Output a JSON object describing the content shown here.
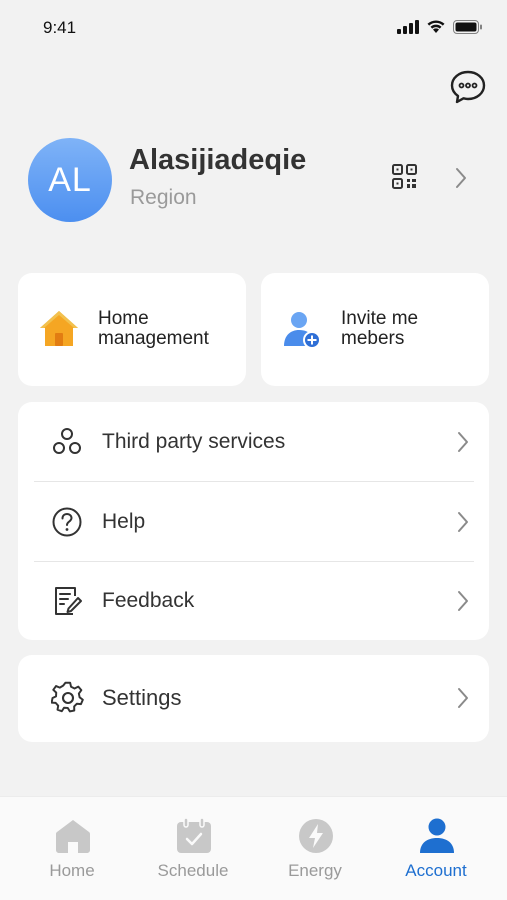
{
  "status_bar": {
    "time": "9:41"
  },
  "profile": {
    "initials": "AL",
    "name": "Alasijiadeqie",
    "region": "Region"
  },
  "tiles": {
    "home": {
      "label_line1": "Home",
      "label_line2": "management",
      "icon": "house-icon"
    },
    "invite": {
      "label_line1": "Invite me",
      "label_line2": "mebers",
      "icon": "add-user-icon"
    }
  },
  "menu": {
    "items": [
      {
        "label": "Third party services",
        "icon": "connections-icon"
      },
      {
        "label": "Help",
        "icon": "question-icon"
      },
      {
        "label": "Feedback",
        "icon": "feedback-icon"
      }
    ],
    "settings": {
      "label": "Settings",
      "icon": "gear-icon"
    }
  },
  "tab_bar": {
    "tabs": [
      {
        "label": "Home",
        "icon": "home-icon"
      },
      {
        "label": "Schedule",
        "icon": "calendar-icon"
      },
      {
        "label": "Energy",
        "icon": "lightning-icon"
      },
      {
        "label": "Account",
        "icon": "person-icon"
      }
    ],
    "active": "Account"
  },
  "colors": {
    "accent": "#1e6fd0",
    "avatar_gradient_top": "#7fb3f7",
    "avatar_gradient_bottom": "#4c8ff0",
    "home_icon": "#f5a623",
    "invite_icon": "#3d7fe0",
    "inactive_tab": "#c8c8c8"
  }
}
